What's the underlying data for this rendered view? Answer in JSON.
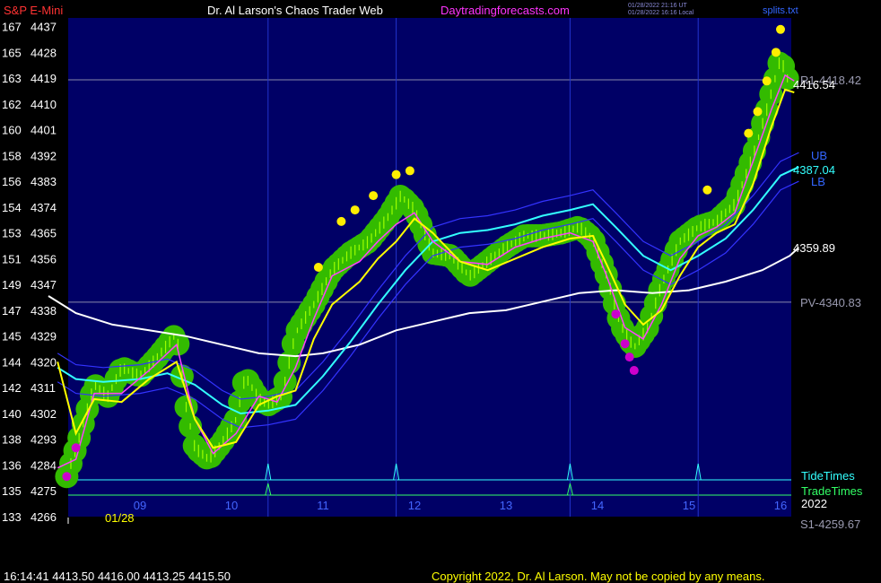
{
  "header": {
    "symbol": "S&P E-Mini",
    "title": "Dr. Al Larson's Chaos Trader Web",
    "site": "Daytradingforecasts.com",
    "stamp_utc": "01/28/2022 21:16 UT",
    "stamp_local": "01/28/2022 16:16 Local",
    "splits_file": "splits.txt"
  },
  "footer": {
    "quote": "16:14:41  4413.50 4416.00 4413.25 4415.50",
    "copyright": "Copyright 2022, Dr. Al Larson. May not be copied by any means."
  },
  "colors": {
    "background": "#000000",
    "plot_bg": "#000066",
    "price": "#9cff00",
    "yellow_ema": "#ffff00",
    "magenta_ema": "#ff40ff",
    "cyan_ma": "#33ffff",
    "band": "#3333ff",
    "white_ma": "#ffffff",
    "halo": "#33bb00",
    "buy_dots": "#ffee00",
    "sell_dots": "#cc00cc",
    "tide": "#33ffff",
    "trade": "#33ff66",
    "header_red": "#ff3333",
    "header_white": "#ffffff",
    "header_magenta": "#ff33ff"
  },
  "chart_data": {
    "type": "line",
    "title": "S&P E-Mini",
    "xlabel": "",
    "ylabel": "",
    "date_label": "01/28",
    "year_label": "2022",
    "x_ticks": [
      "09",
      "10",
      "11",
      "12",
      "13",
      "14",
      "15",
      "16"
    ],
    "ylim": [
      4266,
      4440
    ],
    "y_ticks": [
      {
        "left": "167",
        "price": "4437"
      },
      {
        "left": "165",
        "price": "4428"
      },
      {
        "left": "163",
        "price": "4419"
      },
      {
        "left": "162",
        "price": "4410"
      },
      {
        "left": "160",
        "price": "4401"
      },
      {
        "left": "158",
        "price": "4392"
      },
      {
        "left": "156",
        "price": "4383"
      },
      {
        "left": "154",
        "price": "4374"
      },
      {
        "left": "153",
        "price": "4365"
      },
      {
        "left": "151",
        "price": "4356"
      },
      {
        "left": "149",
        "price": "4347"
      },
      {
        "left": "147",
        "price": "4338"
      },
      {
        "left": "145",
        "price": "4329"
      },
      {
        "left": "144",
        "price": "4320"
      },
      {
        "left": "142",
        "price": "4311"
      },
      {
        "left": "140",
        "price": "4302"
      },
      {
        "left": "138",
        "price": "4293"
      },
      {
        "left": "136",
        "price": "4284"
      },
      {
        "left": "135",
        "price": "4275"
      },
      {
        "left": "133",
        "price": "4266"
      }
    ],
    "levels": [
      {
        "label": "R1-4418.42",
        "value": 4418.42
      },
      {
        "label": "PV-4340.83",
        "value": 4340.83
      },
      {
        "label": "S1-4259.67",
        "value": 4259.67
      }
    ],
    "end_labels": {
      "last_price": "4416.54",
      "cyan_ma": "4387.04",
      "white_ma": "4359.89",
      "upper_band": "UB",
      "lower_band": "LB"
    },
    "legend": [
      "TideTimes",
      "TradeTimes"
    ],
    "tide_times": [
      10.4,
      11.8,
      13.7,
      15.1
    ],
    "trade_times": [
      10.4,
      13.7
    ],
    "series": [
      {
        "name": "price",
        "x": [
          8.2,
          8.35,
          8.5,
          8.65,
          8.8,
          9.0,
          9.2,
          9.4,
          9.5,
          9.6,
          9.75,
          9.9,
          10.05,
          10.15,
          10.3,
          10.4,
          10.55,
          10.7,
          10.9,
          11.1,
          11.3,
          11.5,
          11.7,
          11.85,
          12.0,
          12.2,
          12.4,
          12.6,
          12.8,
          13.0,
          13.2,
          13.4,
          13.6,
          13.8,
          13.95,
          14.1,
          14.25,
          14.4,
          14.55,
          14.7,
          14.9,
          15.1,
          15.3,
          15.5,
          15.7,
          15.85,
          16.0,
          16.1
        ],
        "values": [
          4280,
          4295,
          4312,
          4308,
          4318,
          4315,
          4322,
          4330,
          4305,
          4290,
          4286,
          4292,
          4300,
          4315,
          4307,
          4305,
          4308,
          4330,
          4340,
          4352,
          4358,
          4362,
          4370,
          4378,
          4373,
          4358,
          4357,
          4350,
          4355,
          4360,
          4364,
          4364,
          4365,
          4367,
          4363,
          4350,
          4333,
          4325,
          4332,
          4347,
          4362,
          4367,
          4369,
          4375,
          4392,
          4408,
          4426,
          4416.54
        ]
      },
      {
        "name": "yellow",
        "x": [
          8.1,
          8.3,
          8.5,
          8.8,
          9.1,
          9.4,
          9.6,
          9.8,
          10.05,
          10.3,
          10.5,
          10.7,
          10.9,
          11.1,
          11.4,
          11.6,
          11.8,
          12.0,
          12.2,
          12.5,
          12.8,
          13.1,
          13.4,
          13.7,
          13.95,
          14.1,
          14.3,
          14.5,
          14.7,
          14.9,
          15.1,
          15.3,
          15.5,
          15.7,
          15.9,
          16.05,
          16.15
        ],
        "values": [
          4320,
          4295,
          4307,
          4306,
          4314,
          4320,
          4300,
          4290,
          4292,
          4305,
          4308,
          4310,
          4328,
          4340,
          4348,
          4356,
          4362,
          4370,
          4365,
          4355,
          4352,
          4356,
          4360,
          4363,
          4364,
          4354,
          4340,
          4333,
          4338,
          4350,
          4360,
          4365,
          4368,
          4382,
          4402,
          4415,
          4414
        ]
      },
      {
        "name": "magenta",
        "x": [
          8.1,
          8.3,
          8.5,
          8.8,
          9.1,
          9.4,
          9.6,
          9.8,
          10.05,
          10.3,
          10.5,
          10.7,
          10.9,
          11.1,
          11.4,
          11.6,
          11.8,
          12.0,
          12.2,
          12.5,
          12.8,
          13.1,
          13.4,
          13.7,
          13.95,
          14.1,
          14.3,
          14.5,
          14.7,
          14.9,
          15.1,
          15.3,
          15.5,
          15.7,
          15.9,
          16.05,
          16.15
        ],
        "values": [
          4283,
          4286,
          4309,
          4309,
          4317,
          4326,
          4300,
          4288,
          4295,
          4308,
          4306,
          4318,
          4335,
          4350,
          4355,
          4362,
          4368,
          4372,
          4362,
          4355,
          4354,
          4360,
          4363,
          4365,
          4362,
          4350,
          4332,
          4328,
          4340,
          4356,
          4364,
          4367,
          4372,
          4390,
          4408,
          4420,
          4418
        ]
      },
      {
        "name": "cyan",
        "x": [
          8.1,
          8.3,
          8.6,
          9.0,
          9.3,
          9.6,
          9.9,
          10.1,
          10.4,
          10.7,
          11.0,
          11.3,
          11.6,
          11.9,
          12.2,
          12.5,
          12.8,
          13.1,
          13.4,
          13.7,
          13.95,
          14.2,
          14.5,
          14.8,
          15.1,
          15.4,
          15.7,
          16.0,
          16.2
        ],
        "values": [
          4318,
          4314,
          4313,
          4314,
          4316,
          4312,
          4305,
          4302,
          4303,
          4305,
          4315,
          4327,
          4340,
          4352,
          4362,
          4365,
          4366,
          4368,
          4371,
          4373,
          4375,
          4367,
          4357,
          4352,
          4357,
          4363,
          4373,
          4385,
          4388
        ]
      },
      {
        "name": "white",
        "x": [
          8.0,
          8.3,
          8.7,
          9.1,
          9.5,
          9.9,
          10.3,
          10.7,
          11.0,
          11.4,
          11.8,
          12.2,
          12.6,
          13.0,
          13.4,
          13.8,
          14.2,
          14.6,
          15.0,
          15.4,
          15.8,
          16.1,
          16.2
        ],
        "values": [
          4343,
          4337,
          4333,
          4331,
          4329,
          4326,
          4323,
          4322,
          4323,
          4326,
          4331,
          4334,
          4337,
          4338,
          4341,
          4344,
          4345,
          4344,
          4345,
          4348,
          4352,
          4357,
          4359.89
        ]
      }
    ]
  }
}
